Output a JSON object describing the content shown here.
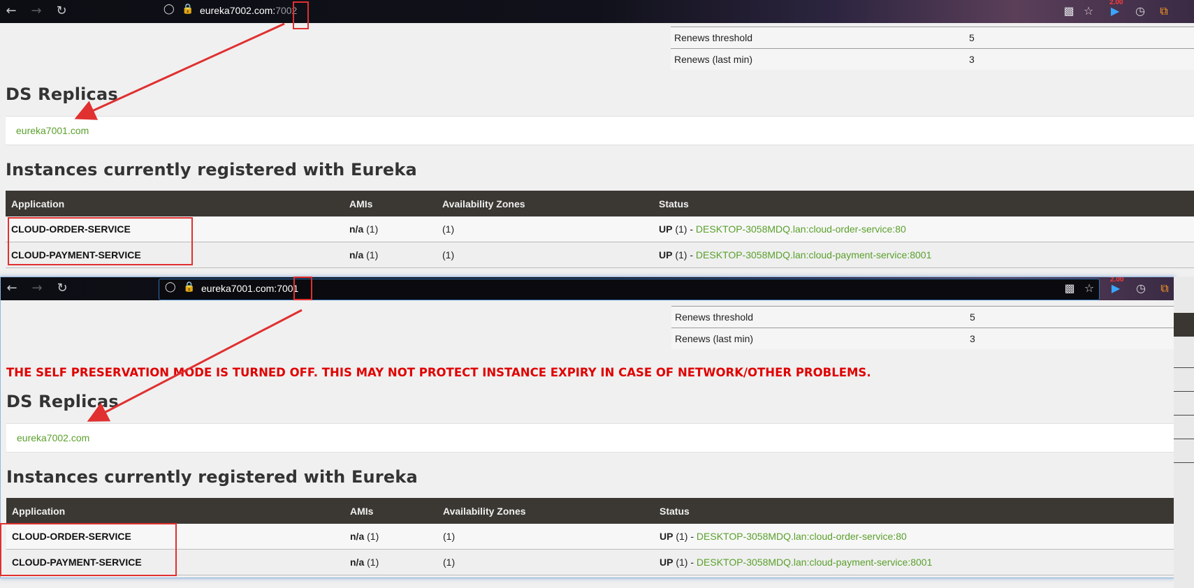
{
  "top_window": {
    "url_host": "eureka7002.com:",
    "url_port": "7002",
    "badge": "2.00",
    "stats": [
      {
        "label": "Renews threshold",
        "value": "5"
      },
      {
        "label": "Renews (last min)",
        "value": "3"
      }
    ],
    "replicas_title": "DS Replicas",
    "replica": "eureka7001.com",
    "instances_title": "Instances currently registered with Eureka",
    "columns": [
      "Application",
      "AMIs",
      "Availability Zones",
      "Status"
    ],
    "rows": [
      {
        "app": "CLOUD-ORDER-SERVICE",
        "ami_na": "n/a",
        "ami_count": " (1)",
        "zones": "(1)",
        "status_up": "UP",
        "status_count": " (1) - ",
        "status_link": "DESKTOP-3058MDQ.lan:cloud-order-service:80"
      },
      {
        "app": "CLOUD-PAYMENT-SERVICE",
        "ami_na": "n/a",
        "ami_count": " (1)",
        "zones": "(1)",
        "status_up": "UP",
        "status_count": " (1) - ",
        "status_link": "DESKTOP-3058MDQ.lan:cloud-payment-service:8001"
      }
    ]
  },
  "bottom_window": {
    "url_host": "eureka7001.com:",
    "url_port": "7001",
    "badge": "2.00",
    "stats": [
      {
        "label": "Renews threshold",
        "value": "5"
      },
      {
        "label": "Renews (last min)",
        "value": "3"
      }
    ],
    "warning": "THE SELF PRESERVATION MODE IS TURNED OFF. THIS MAY NOT PROTECT INSTANCE EXPIRY IN CASE OF NETWORK/OTHER PROBLEMS.",
    "replicas_title": "DS Replicas",
    "replica": "eureka7002.com",
    "instances_title": "Instances currently registered with Eureka",
    "columns": [
      "Application",
      "AMIs",
      "Availability Zones",
      "Status"
    ],
    "rows": [
      {
        "app": "CLOUD-ORDER-SERVICE",
        "ami_na": "n/a",
        "ami_count": " (1)",
        "zones": "(1)",
        "status_up": "UP",
        "status_count": " (1) - ",
        "status_link": "DESKTOP-3058MDQ.lan:cloud-order-service:80"
      },
      {
        "app": "CLOUD-PAYMENT-SERVICE",
        "ami_na": "n/a",
        "ami_count": " (1)",
        "zones": "(1)",
        "status_up": "UP",
        "status_count": " (1) - ",
        "status_link": "DESKTOP-3058MDQ.lan:cloud-payment-service:8001"
      }
    ]
  },
  "colors": {
    "link_green": "#5aa02c",
    "warning_red": "#e00000",
    "annotation_red": "#e03030",
    "table_header": "#3b3834"
  },
  "icons": [
    "back-arrow-icon",
    "forward-arrow-icon",
    "reload-icon",
    "shield-icon",
    "lock-icon",
    "qr-code-icon",
    "star-icon",
    "play-icon",
    "history-icon",
    "crop-icon"
  ]
}
